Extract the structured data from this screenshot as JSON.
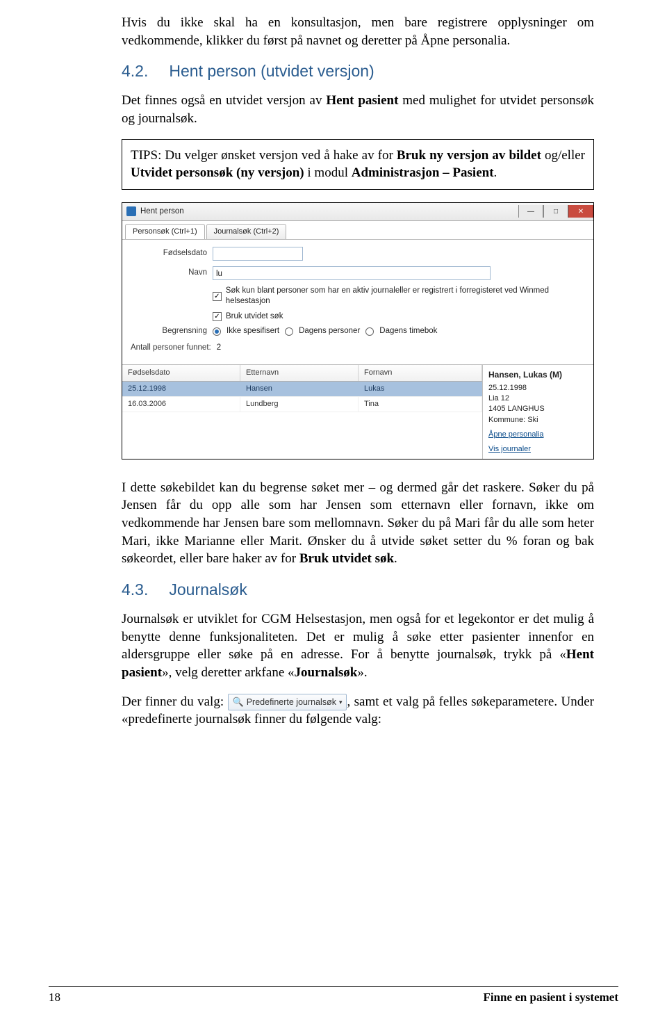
{
  "intro_para": "Hvis du ikke skal ha en konsultasjon, men bare registrere opplysninger om vedkommende, klikker du først på navnet og deretter på Åpne personalia.",
  "sec42": {
    "num": "4.2.",
    "title": "Hent person (utvidet versjon)",
    "para1a": "Det finnes også en utvidet versjon av ",
    "para1b": "Hent pasient",
    "para1c": " med mulighet for utvidet personsøk og journalsøk.",
    "tip_a": "TIPS: Du velger ønsket versjon ved å hake av for ",
    "tip_b": "Bruk ny versjon av bildet",
    "tip_c": " og/eller ",
    "tip_d": "Utvidet personsøk (ny versjon)",
    "tip_e": " i modul ",
    "tip_f": "Administrasjon – Pasient",
    "tip_g": "."
  },
  "screenshot": {
    "title": "Hent person",
    "tabs": [
      "Personsøk (Ctrl+1)",
      "Journalsøk (Ctrl+2)"
    ],
    "labels": {
      "fdato": "Fødselsdato",
      "navn": "Navn",
      "begrensning": "Begrensning",
      "antall": "Antall personer funnet:"
    },
    "navn_value": "lu",
    "chk_aktiv": "Søk kun blant personer som har en aktiv journaleller er registrert i forregisteret ved Winmed helsestasjon",
    "chk_utvidet": "Bruk utvidet søk",
    "radios": [
      "Ikke spesifisert",
      "Dagens personer",
      "Dagens timebok"
    ],
    "antall_value": "2",
    "headers": [
      "Fødselsdato",
      "Etternavn",
      "Fornavn"
    ],
    "rows": [
      {
        "fdato": "25.12.1998",
        "etternavn": "Hansen",
        "fornavn": "Lukas"
      },
      {
        "fdato": "16.03.2006",
        "etternavn": "Lundberg",
        "fornavn": "Tina"
      }
    ],
    "side": {
      "name": "Hansen, Lukas (M)",
      "dato": "25.12.1998",
      "adr1": "Lia 12",
      "adr2": "1405 LANGHUS",
      "kommune": "Kommune: Ski",
      "link1": "Åpne personalia",
      "link2": "Vis journaler"
    }
  },
  "post_shot": {
    "a": "I dette søkebildet kan du begrense søket mer – og dermed går det raskere. Søker du på Jensen får du opp alle som har Jensen som etternavn eller fornavn, ikke om vedkommende har Jensen bare som mellomnavn. Søker du på Mari får du alle som heter Mari, ikke Marianne eller Marit. Ønsker du å utvide søket setter du % foran og bak søkeordet, eller bare haker av for ",
    "b": "Bruk utvidet søk",
    "c": "."
  },
  "sec43": {
    "num": "4.3.",
    "title": "Journalsøk",
    "p1a": "Journalsøk er utviklet for CGM Helsestasjon, men også for et legekontor er det mulig å benytte denne funksjonaliteten. Det er mulig å søke etter pasienter innenfor en aldersgruppe eller søke på en adresse. For å benytte journalsøk, trykk på «",
    "p1b": "Hent pasient",
    "p1c": "», velg deretter arkfane «",
    "p1d": "Journalsøk",
    "p1e": "».",
    "p2a": "Der finner du valg: ",
    "btn": "Predefinerte journalsøk",
    "p2b": ", samt et valg på felles søkeparametere. Under «predefinerte journalsøk finner du følgende valg:"
  },
  "footer": {
    "page": "18",
    "title": "Finne en pasient i systemet"
  }
}
